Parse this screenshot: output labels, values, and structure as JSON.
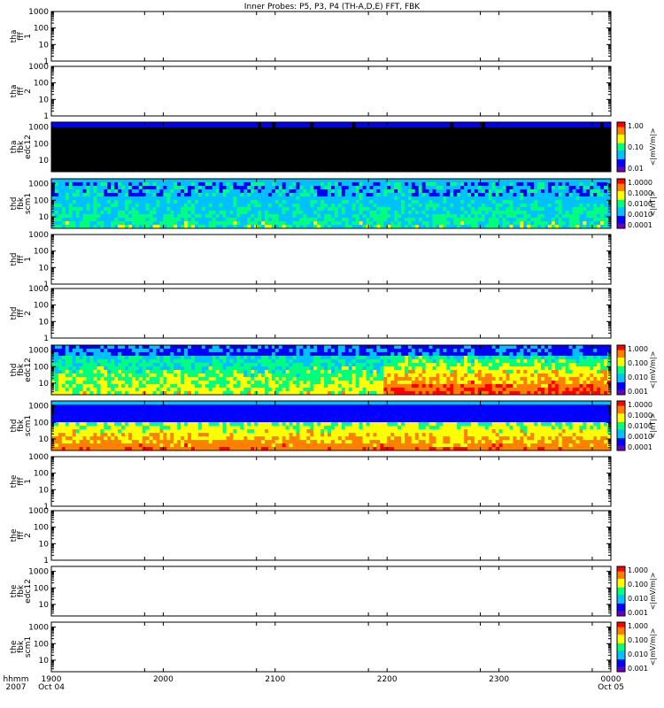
{
  "title": "Inner Probes: P5, P3, P4 (TH-A,D,E) FFT, FBK",
  "x_axis": {
    "header": [
      "hhmm",
      "2007"
    ],
    "ticks": [
      {
        "t": 1900,
        "top": "1900",
        "bottom": "Oct 04"
      },
      {
        "t": 1950,
        "top": "",
        "bottom": ""
      },
      {
        "t": 2000,
        "top": "2000",
        "bottom": ""
      },
      {
        "t": 2050,
        "top": "",
        "bottom": ""
      },
      {
        "t": 2100,
        "top": "2100",
        "bottom": ""
      },
      {
        "t": 2150,
        "top": "",
        "bottom": ""
      },
      {
        "t": 2200,
        "top": "2200",
        "bottom": ""
      },
      {
        "t": 2250,
        "top": "",
        "bottom": ""
      },
      {
        "t": 2300,
        "top": "2300",
        "bottom": ""
      },
      {
        "t": 2350,
        "top": "",
        "bottom": ""
      },
      {
        "t": 2400,
        "top": "0000",
        "bottom": "Oct 05"
      }
    ]
  },
  "colors": {
    "black": "#000000",
    "dark_blue": "#0000ff",
    "cyan_blue": "#33ccff",
    "spectrum": [
      "#6a00b0",
      "#0000ff",
      "#00c0ff",
      "#00ff80",
      "#ffff00",
      "#ff8000",
      "#ff0000"
    ]
  },
  "chart_data": [
    {
      "type": "heatmap",
      "panel": "tha-fff-1",
      "ylabel": [
        "tha",
        "fff",
        "1"
      ],
      "y_ticks": [
        "1000",
        "100",
        "10",
        "1"
      ],
      "ylim": [
        1,
        1000
      ],
      "y_scale": "log",
      "filled": false
    },
    {
      "type": "heatmap",
      "panel": "tha-fff-2",
      "ylabel": [
        "tha",
        "fff",
        "2"
      ],
      "y_ticks": [
        "1000",
        "100",
        "10",
        "1"
      ],
      "ylim": [
        1,
        1000
      ],
      "y_scale": "log",
      "filled": false
    },
    {
      "type": "heatmap",
      "panel": "tha-fbk-edc12",
      "ylabel": [
        "tha",
        "fbk",
        "edc12"
      ],
      "y_ticks": [
        "1000",
        "100",
        "10"
      ],
      "ylim": [
        2,
        2000
      ],
      "y_scale": "log",
      "filled": true,
      "pattern": "tha",
      "colorbar": {
        "ticks": [
          "1.00",
          "0.10",
          "0.01"
        ],
        "unit": "<|mV/m|>"
      }
    },
    {
      "type": "heatmap",
      "panel": "thd-fbk-scm1",
      "ylabel": [
        "thd",
        "fbk",
        "scm1"
      ],
      "y_ticks": [
        "1000",
        "100",
        "10"
      ],
      "ylim": [
        2,
        2000
      ],
      "y_scale": "log",
      "filled": true,
      "pattern": "thd_scm",
      "colorbar": {
        "ticks": [
          "1.0000",
          "0.1000",
          "0.0100",
          "0.0010",
          "0.0001"
        ],
        "unit": "<|nT|>"
      }
    },
    {
      "type": "heatmap",
      "panel": "thd-fff-1",
      "ylabel": [
        "thd",
        "fff",
        "1"
      ],
      "y_ticks": [
        "1000",
        "100",
        "10",
        "1"
      ],
      "ylim": [
        1,
        1000
      ],
      "y_scale": "log",
      "filled": false
    },
    {
      "type": "heatmap",
      "panel": "thd-fff-2",
      "ylabel": [
        "thd",
        "fff",
        "2"
      ],
      "y_ticks": [
        "1000",
        "100",
        "10",
        "1"
      ],
      "ylim": [
        1,
        1000
      ],
      "y_scale": "log",
      "filled": false
    },
    {
      "type": "heatmap",
      "panel": "thd-fbk-edc12",
      "ylabel": [
        "thd",
        "fbk",
        "edc12"
      ],
      "y_ticks": [
        "1000",
        "100",
        "10"
      ],
      "ylim": [
        2,
        2000
      ],
      "y_scale": "log",
      "filled": true,
      "pattern": "thd_edc",
      "colorbar": {
        "ticks": [
          "1.000",
          "0.100",
          "0.010",
          "0.001"
        ],
        "unit": "<|mV/m|>"
      }
    },
    {
      "type": "heatmap",
      "panel": "thd-fbk-scm1-2",
      "ylabel": [
        "thd",
        "fbk",
        "scm1"
      ],
      "y_ticks": [
        "1000",
        "100",
        "10"
      ],
      "ylim": [
        2,
        2000
      ],
      "y_scale": "log",
      "filled": true,
      "pattern": "thd_scm2",
      "colorbar": {
        "ticks": [
          "1.0000",
          "0.1000",
          "0.0100",
          "0.0010",
          "0.0001"
        ],
        "unit": "<|nT|>"
      }
    },
    {
      "type": "heatmap",
      "panel": "the-fff-1",
      "ylabel": [
        "the",
        "fff",
        "1"
      ],
      "y_ticks": [
        "1000",
        "100",
        "10",
        "1"
      ],
      "ylim": [
        1,
        1000
      ],
      "y_scale": "log",
      "filled": false
    },
    {
      "type": "heatmap",
      "panel": "the-fff-2",
      "ylabel": [
        "the",
        "fff",
        "2"
      ],
      "y_ticks": [
        "1000",
        "100",
        "10",
        "1"
      ],
      "ylim": [
        1,
        1000
      ],
      "y_scale": "log",
      "filled": false
    },
    {
      "type": "heatmap",
      "panel": "the-fbk-edc12",
      "ylabel": [
        "the",
        "fbk",
        "edc12"
      ],
      "y_ticks": [
        "1000",
        "100",
        "10"
      ],
      "ylim": [
        2,
        2000
      ],
      "y_scale": "log",
      "filled": false,
      "colorbar": {
        "ticks": [
          "1.000",
          "0.100",
          "0.010",
          "0.001"
        ],
        "unit": "<|mV/m|>"
      }
    },
    {
      "type": "heatmap",
      "panel": "the-fbk-scm1",
      "ylabel": [
        "the",
        "fbk",
        "scm1"
      ],
      "y_ticks": [
        "1000",
        "100",
        "10"
      ],
      "ylim": [
        2,
        2000
      ],
      "y_scale": "log",
      "filled": false,
      "colorbar": {
        "ticks": [
          "1.000",
          "0.100",
          "0.010",
          "0.001"
        ],
        "unit": "<|mV/m|>"
      }
    }
  ]
}
